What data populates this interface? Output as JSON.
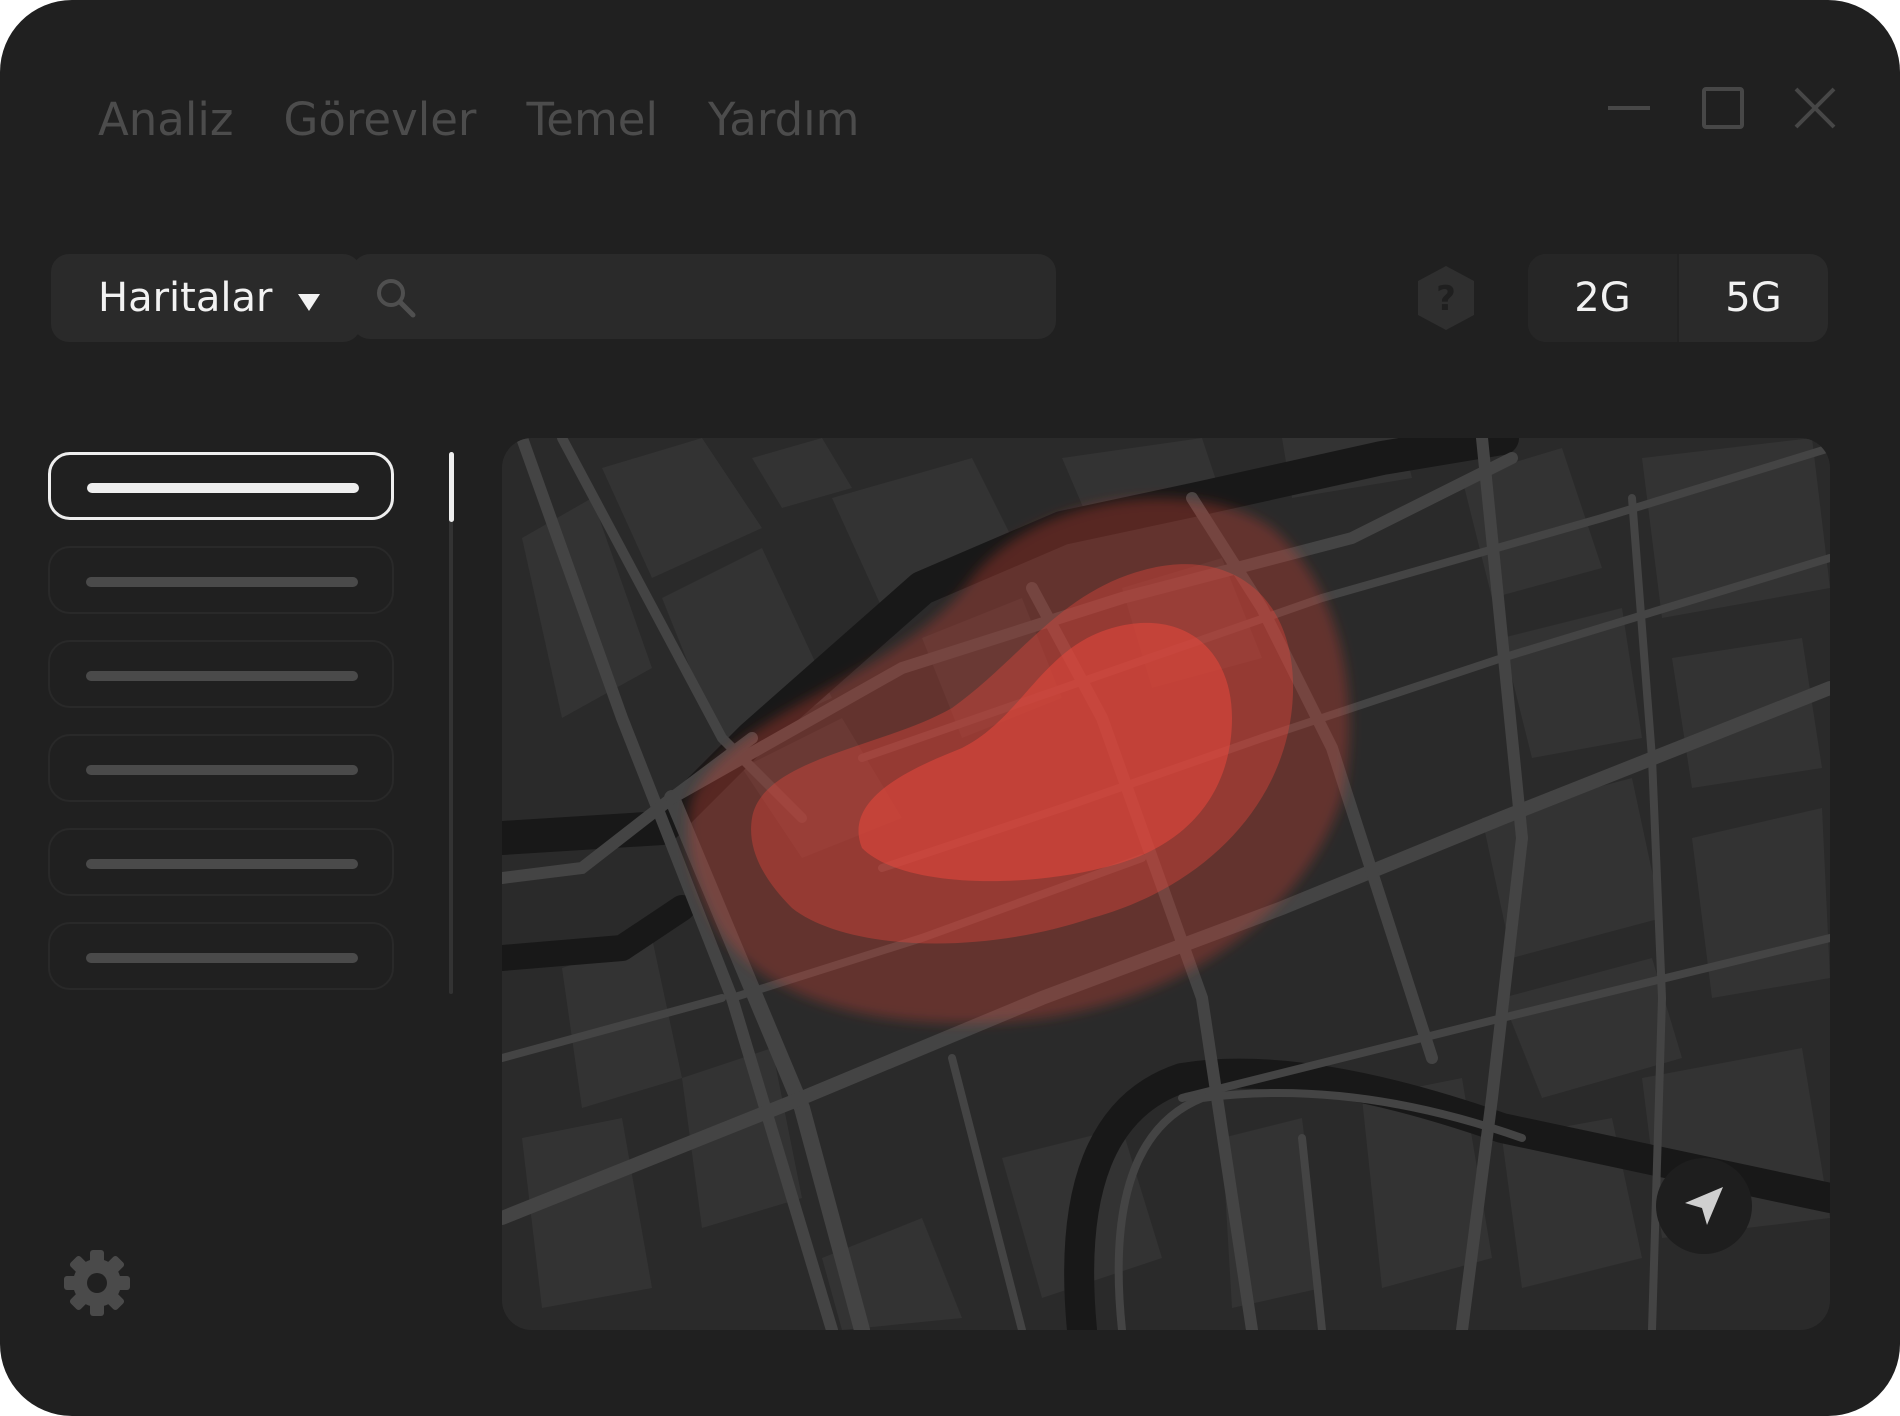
{
  "menu": {
    "items": [
      "Analiz",
      "Görevler",
      "Temel",
      "Yardım"
    ]
  },
  "toolbar": {
    "category_label": "Haritalar",
    "search_placeholder": "",
    "band_options": [
      "2G",
      "5G"
    ],
    "active_band": "2G"
  },
  "sidebar": {
    "item_count": 6,
    "selected_index": 0
  },
  "icons": {
    "minimize": "minimize-icon",
    "maximize": "maximize-icon",
    "close": "close-icon",
    "search": "search-icon",
    "help": "help-hexagon-icon",
    "settings": "gear-icon",
    "locate": "navigation-arrow-icon",
    "dropdown": "caret-down-icon"
  },
  "colors": {
    "window_bg": "#202020",
    "control_bg": "#2a2a2a",
    "menu_text": "#4c4c4c",
    "text": "#f2f2f2",
    "heatmap": "#e8473c"
  }
}
